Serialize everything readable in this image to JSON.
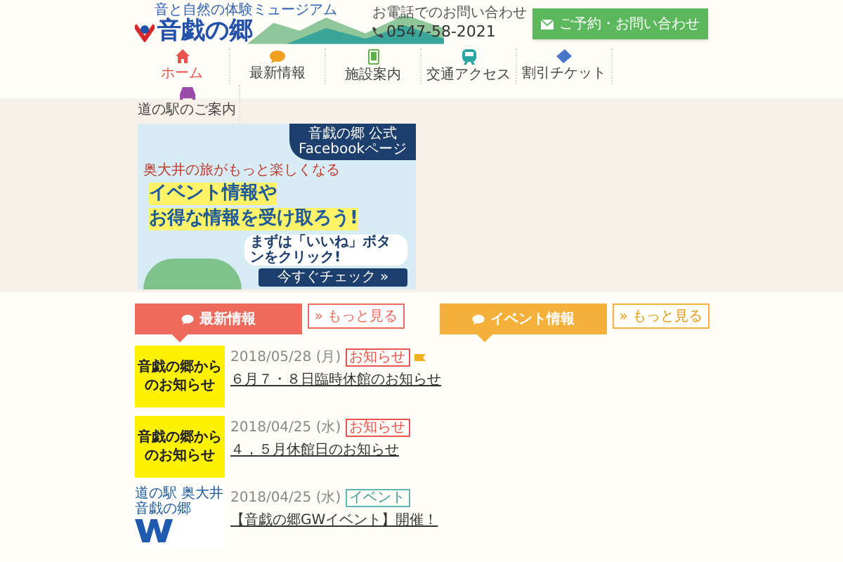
{
  "header": {
    "tagline": "音と自然の体験ミュージアム",
    "logo": "音戯の郷",
    "phone_label": "お電話でのお問い合わせ",
    "phone": "0547-58-2021",
    "contact_button": "ご予約・お問い合わせ"
  },
  "nav": [
    {
      "label": "ホーム",
      "selected": true,
      "kind": "home",
      "color": "#e8554e"
    },
    {
      "label": "最新情報",
      "selected": false,
      "kind": "chat",
      "color": "#f0a020"
    },
    {
      "label": "施設案内",
      "selected": false,
      "kind": "phone",
      "color": "#5fb04a"
    },
    {
      "label": "交通アクセス",
      "selected": false,
      "kind": "train",
      "color": "#2aa6a0"
    },
    {
      "label": "割引チケット",
      "selected": false,
      "kind": "ticket",
      "color": "#4a78c8"
    },
    {
      "label": "道の駅のご案内",
      "selected": false,
      "kind": "car",
      "color": "#9a4aa8"
    }
  ],
  "banner": {
    "badge_1": "音戯の郷 公式",
    "badge_2": "Facebookページ",
    "lead": "奥大井の旅がもっと楽しくなる",
    "headline_1": "イベント情報や",
    "headline_2": "お得な情報を受け取ろう!",
    "like_text": "まずは「いいね」ボタンをクリック!",
    "cta": "今すぐチェック »"
  },
  "sections": [
    {
      "title": "最新情報",
      "more": "» もっと見る",
      "kind": "news",
      "items": [
        {
          "thumb": "音戯の郷からのお知らせ",
          "kind": "notice",
          "date": "2018/05/28 (月)",
          "tag": "お知らせ",
          "new": true,
          "title": "６月７・８日臨時休館のお知らせ"
        },
        {
          "thumb": "音戯の郷からのお知らせ",
          "kind": "notice",
          "date": "2018/04/25 (水)",
          "tag": "お知らせ",
          "new": false,
          "title": "４，５月休館日のお知らせ"
        },
        {
          "thumb": "道の駅 奥大井音戯の郷",
          "kind": "event",
          "date": "2018/04/25 (水)",
          "tag": "イベント",
          "new": false,
          "title": "【音戯の郷GWイベント】開催！"
        }
      ]
    },
    {
      "title": "イベント情報",
      "more": "» もっと見る",
      "kind": "event"
    }
  ]
}
